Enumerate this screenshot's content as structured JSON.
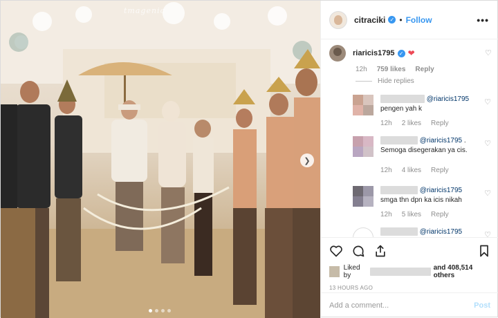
{
  "photo": {
    "watermark": "tmagenic",
    "alt_description_icon": "wedding-photo",
    "carousel": {
      "count": 4,
      "active": 1
    }
  },
  "header": {
    "username": "citraciki",
    "separator": "•",
    "follow_label": "Follow",
    "more_label": "•••"
  },
  "main_comment": {
    "username": "riaricis1795",
    "time": "12h",
    "likes": "759 likes",
    "reply_label": "Reply",
    "hide_replies": "Hide replies"
  },
  "replies": [
    {
      "mention": "@riaricis1795",
      "text": "pengen yah k",
      "time": "12h",
      "likes": "2 likes",
      "reply_label": "Reply"
    },
    {
      "mention": "@riaricis1795",
      "suffix": ".",
      "text": "Semoga disegerakan ya cis.",
      "time": "12h",
      "likes": "4 likes",
      "reply_label": "Reply"
    },
    {
      "mention": "@riaricis1795",
      "text": "smga thn dpn ka icis nikah",
      "time": "12h",
      "likes": "5 likes",
      "reply_label": "Reply"
    },
    {
      "mention": "@riaricis1795"
    }
  ],
  "footer": {
    "liked_by": "Liked by",
    "and_others": "and 408,514 others",
    "timestamp": "13 HOURS AGO",
    "add_comment_placeholder": "Add a comment...",
    "post_label": "Post"
  },
  "colors": {
    "accent": "#3897f0",
    "heart": "#ed4956",
    "muted": "#8e8e8e",
    "post_disabled": "#b2dffc"
  }
}
